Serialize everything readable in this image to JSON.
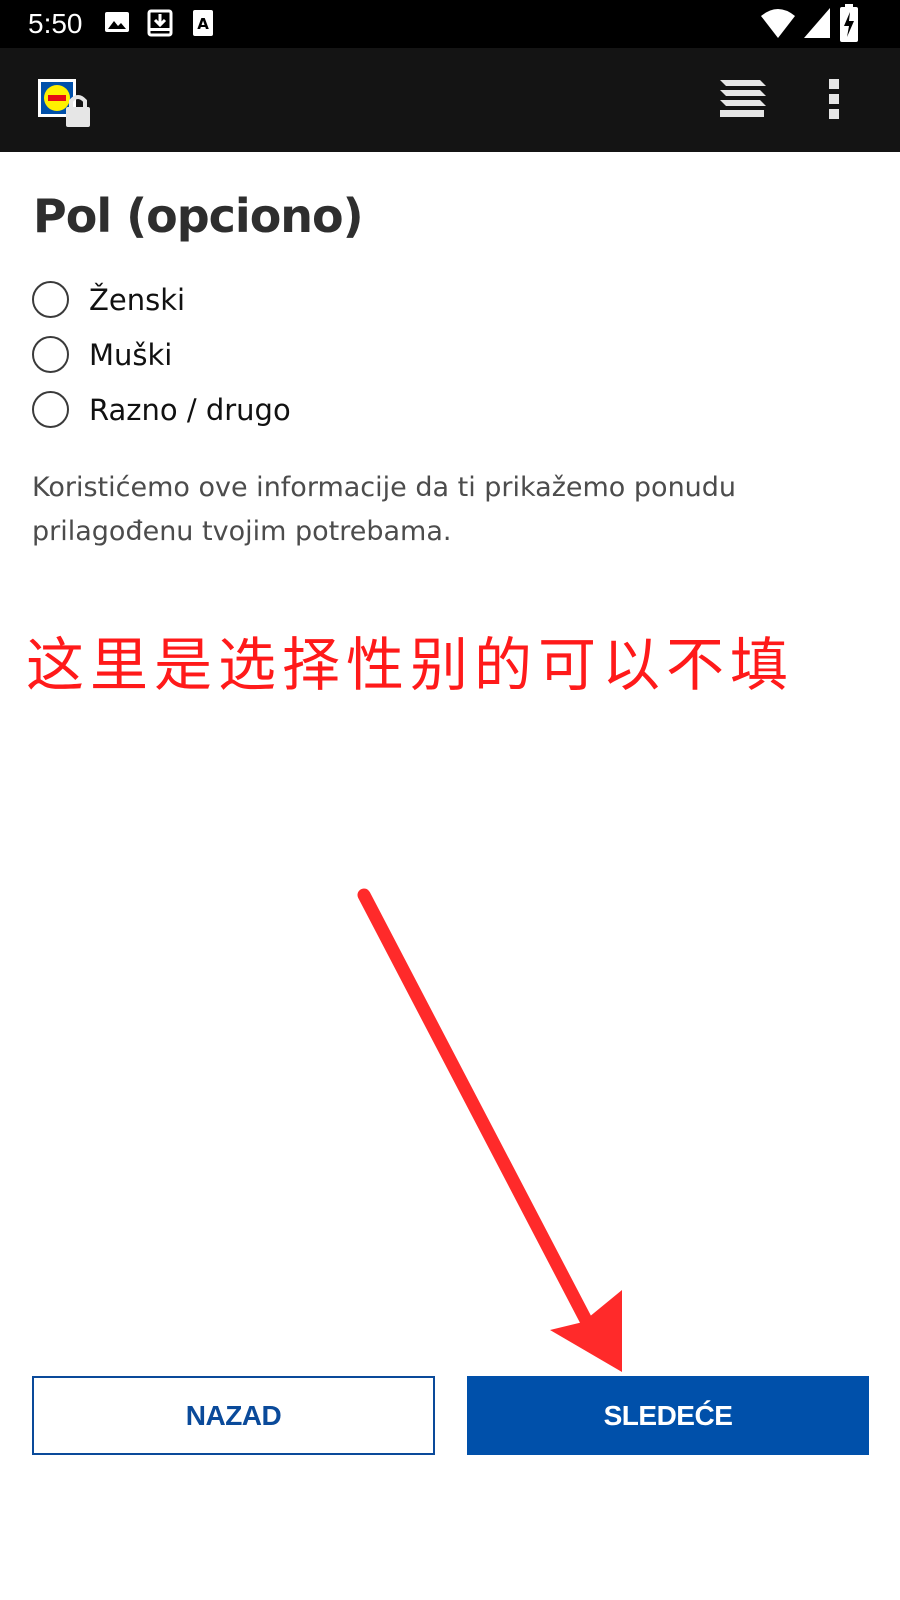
{
  "status_bar": {
    "time": "5:50",
    "icons": [
      "image-icon",
      "download-icon",
      "text-a-icon",
      "wifi-icon",
      "signal-icon",
      "battery-charging-icon"
    ]
  },
  "toolbar": {
    "logo_icon": "lidl-logo-lock-icon",
    "actions": [
      "stack-layers-icon",
      "more-vert-icon"
    ]
  },
  "page": {
    "title": "Pol (opciono)",
    "options": [
      {
        "label": "Ženski",
        "selected": false
      },
      {
        "label": "Muški",
        "selected": false
      },
      {
        "label": "Razno / drugo",
        "selected": false
      }
    ],
    "description": "Koristićemo ove informacije da ti prikažemo ponudu prilagođenu tvojim potrebama."
  },
  "annotation": {
    "text": "这里是选择性别的可以不填",
    "color": "#ff1a1a"
  },
  "buttons": {
    "back_label": "NAZAD",
    "next_label": "SLEDEĆE"
  },
  "colors": {
    "primary": "#0050aa",
    "toolbar_bg": "#141414",
    "status_bg": "#000000"
  }
}
